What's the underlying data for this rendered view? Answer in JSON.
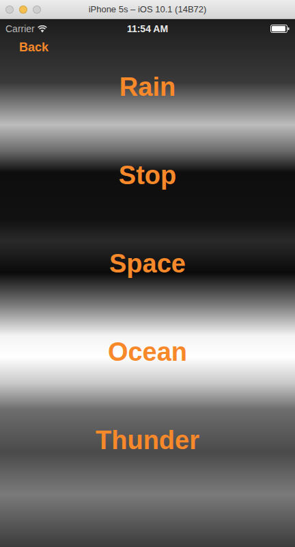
{
  "window": {
    "title": "iPhone 5s – iOS 10.1 (14B72)"
  },
  "status_bar": {
    "carrier": "Carrier",
    "time": "11:54 AM",
    "battery": {
      "level": 0.95
    }
  },
  "navigation": {
    "back": "Back"
  },
  "sounds": [
    {
      "label": "Rain"
    },
    {
      "label": "Stop"
    },
    {
      "label": "Space"
    },
    {
      "label": "Ocean"
    },
    {
      "label": "Thunder"
    }
  ]
}
